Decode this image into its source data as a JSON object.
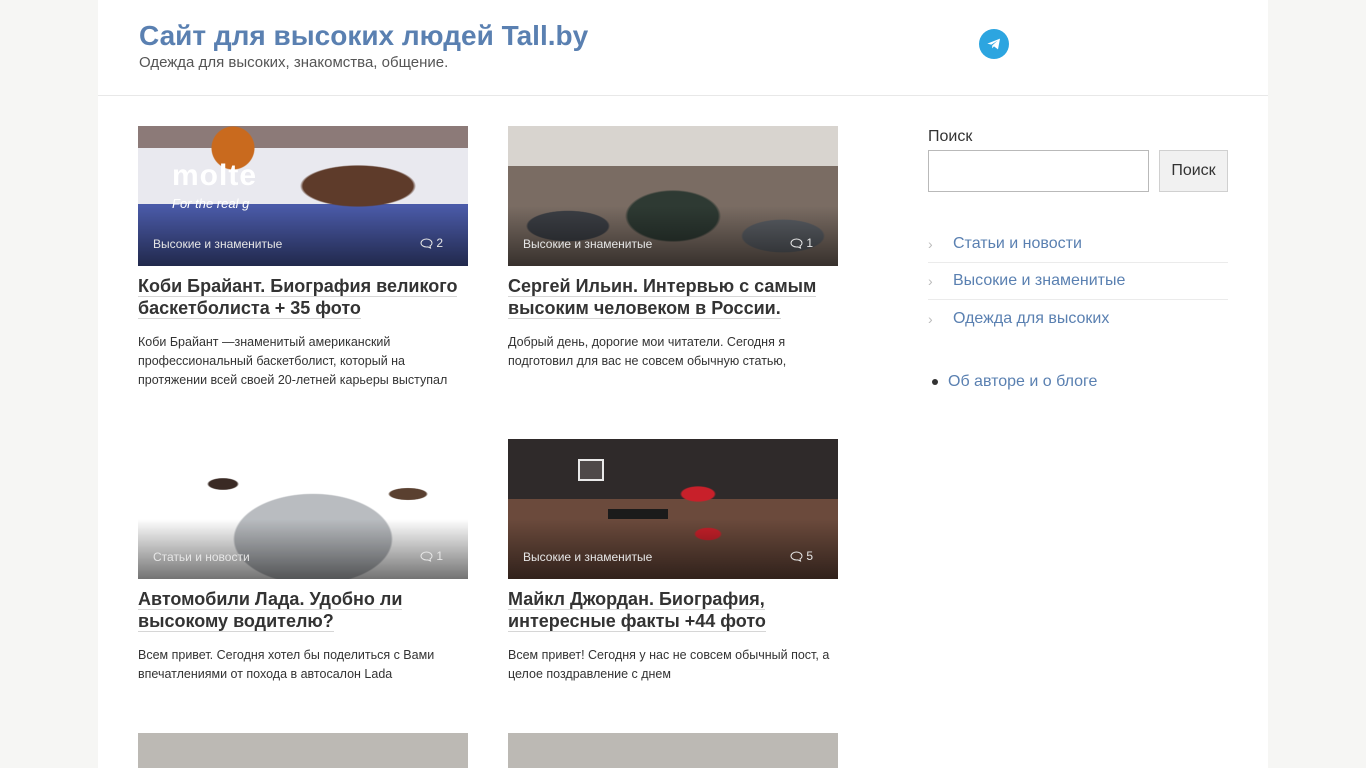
{
  "header": {
    "site_title": "Сайт для высоких людей Tall.by",
    "site_description": "Одежда для высоких, знакомства, общение."
  },
  "posts": [
    {
      "category": "Высокие и знаменитые",
      "comments": "2",
      "title": "Коби Брайант. Биография великого баскетболиста + 35 фото",
      "excerpt": "Коби Брайант —знаменитый американский профессиональный баскетболист, который на протяжении всей своей 20-летней карьеры выступал"
    },
    {
      "category": "Высокие и знаменитые",
      "comments": "1",
      "title": "Сергей Ильин. Интервью с самым высоким человеком в России.",
      "excerpt": "Добрый день, дорогие мои читатели. Сегодня я подготовил для вас не совсем обычную статью,"
    },
    {
      "category": "Статьи и новости",
      "comments": "1",
      "title": "Автомобили Лада. Удобно ли высокому водителю?",
      "excerpt": "Всем привет. Сегодня хотел бы поделиться с Вами впечатлениями от похода в автосалон Lada"
    },
    {
      "category": "Высокие и знаменитые",
      "comments": "5",
      "title": "Майкл Джордан. Биография, интересные факты +44 фото",
      "excerpt": "Всем привет! Сегодня у нас не совсем обычный пост, а целое поздравление с днем"
    }
  ],
  "sidebar": {
    "search_label": "Поиск",
    "search_value": "",
    "search_button": "Поиск",
    "categories": [
      "Статьи и новости",
      "Высокие и знаменитые",
      "Одежда для высоких"
    ],
    "pages": [
      "Об авторе и о блоге"
    ]
  },
  "colors": {
    "link": "#5a80b1",
    "telegram": "#2ca5e0"
  },
  "icons": {
    "social": "telegram-icon",
    "comments": "comment-bubble-icon",
    "category_bullet": "chevron-right-icon"
  }
}
